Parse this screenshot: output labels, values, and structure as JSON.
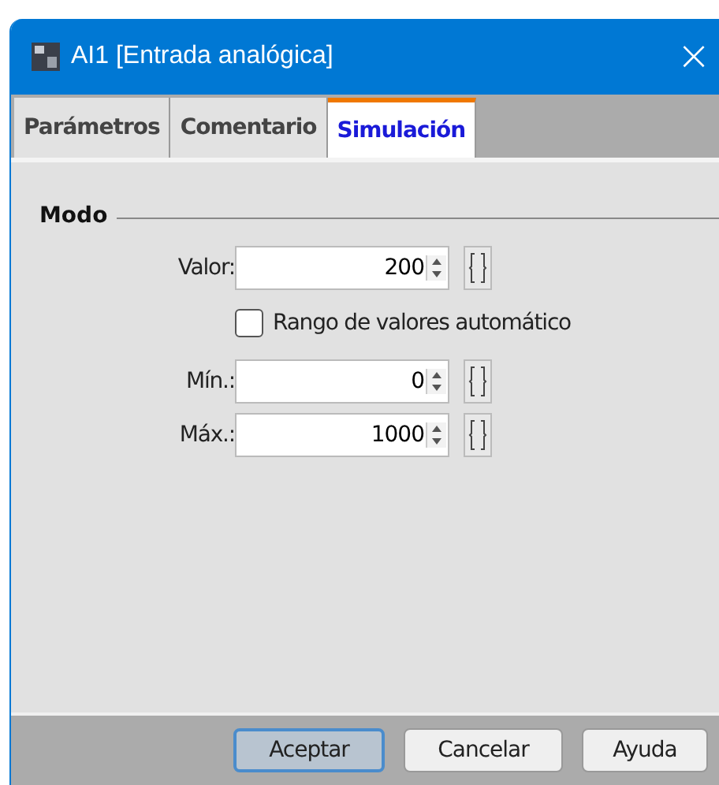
{
  "window": {
    "title": "AI1 [Entrada analógica]",
    "close": "×"
  },
  "tabs": [
    {
      "label": "Parámetros",
      "selected": false
    },
    {
      "label": "Comentario",
      "selected": false
    },
    {
      "label": "Simulación",
      "selected": true
    }
  ],
  "group": {
    "title": "Modo"
  },
  "fields": [
    {
      "kind": "spin",
      "label": "Valor:",
      "value": "200"
    },
    {
      "kind": "check",
      "label": "Rango de valores automático",
      "checked": false
    },
    {
      "kind": "spin",
      "label": "Mín.:",
      "value": "0"
    },
    {
      "kind": "spin",
      "label": "Máx.:",
      "value": "1000"
    }
  ],
  "buttons": [
    {
      "label": "Aceptar",
      "default": true
    },
    {
      "label": "Cancelar",
      "default": false
    },
    {
      "label": "Ayuda",
      "default": false
    }
  ]
}
